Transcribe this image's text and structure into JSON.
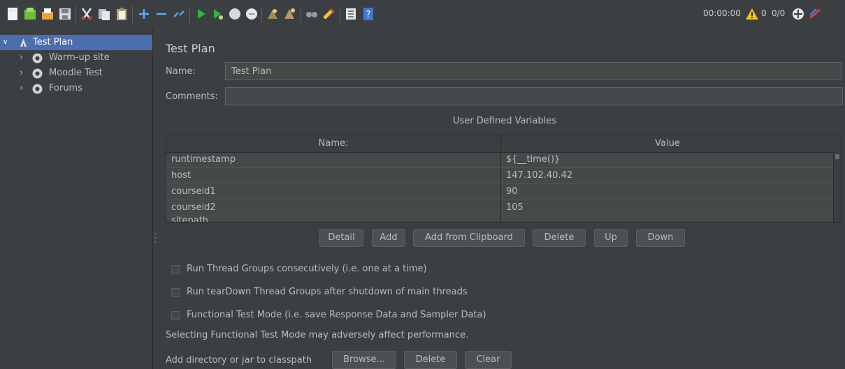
{
  "toolbar": {
    "icons": [
      "new-icon",
      "templates-icon",
      "open-icon",
      "save-icon",
      "cut-icon",
      "copy-icon",
      "paste-icon",
      "expand-icon",
      "collapse-icon",
      "toggle-icon",
      "start-icon",
      "start-no-pauses-icon",
      "stop-icon",
      "shutdown-icon",
      "clear-icon",
      "clear-all-icon",
      "search-icon",
      "reset-search-icon",
      "function-helper-icon",
      "help-icon"
    ],
    "elapsed": "00:00:00",
    "warning_count": "0",
    "threads": "0/0"
  },
  "tree": {
    "root": "Test Plan",
    "children": [
      "Warm-up site",
      "Moodle Test",
      "Forums"
    ]
  },
  "panel": {
    "title": "Test Plan",
    "name_label": "Name:",
    "name_value": "Test Plan",
    "comments_label": "Comments:",
    "comments_value": ""
  },
  "variables": {
    "title": "User Defined Variables",
    "columns": [
      "Name:",
      "Value"
    ],
    "rows": [
      {
        "name": "runtimestamp",
        "value": "${__time()}"
      },
      {
        "name": "host",
        "value": "147.102.40.42"
      },
      {
        "name": "courseid1",
        "value": "90"
      },
      {
        "name": "courseid2",
        "value": "105"
      }
    ],
    "partial_row": "sitepath"
  },
  "buttons": {
    "detail": "Detail",
    "add": "Add",
    "add_clipboard": "Add from Clipboard",
    "delete": "Delete",
    "up": "Up",
    "down": "Down"
  },
  "options": {
    "consecutive": "Run Thread Groups consecutively (i.e. one at a time)",
    "teardown": "Run tearDown Thread Groups after shutdown of main threads",
    "functional": "Functional Test Mode (i.e. save Response Data and Sampler Data)",
    "functional_checked": false,
    "teardown_checked": false,
    "consecutive_checked": false,
    "note": "Selecting Functional Test Mode may adversely affect performance."
  },
  "classpath": {
    "label": "Add directory or jar to classpath",
    "browse": "Browse...",
    "delete": "Delete",
    "clear": "Clear"
  },
  "colors": {
    "background": "#3c3f41",
    "selection": "#4b6eaf",
    "field": "#45494a"
  }
}
